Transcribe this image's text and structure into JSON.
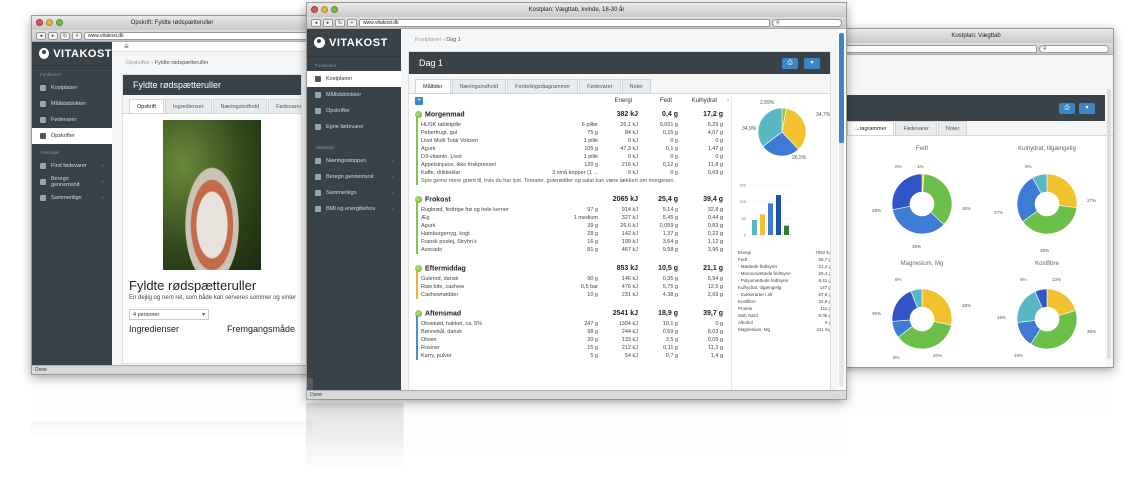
{
  "left_window": {
    "title": "Opskrift: Fyldte rødspætteruller",
    "url": "www.vitakost.dk",
    "logo": "VITAKOST",
    "sidebar_group1": "Funktioner",
    "sidebar_items": [
      {
        "label": "Kostplaner",
        "active": false
      },
      {
        "label": "Måltidsblokker",
        "active": false
      },
      {
        "label": "Fødevarer",
        "active": false
      },
      {
        "label": "Opskrifter",
        "active": true
      }
    ],
    "sidebar_group2": "Værktøjer",
    "sidebar_tools": [
      {
        "label": "Find fødevarer"
      },
      {
        "label": "Beregn gennemsnit"
      },
      {
        "label": "Sammenlign"
      }
    ],
    "breadcrumb": [
      "Opskrifter",
      "Fyldte rødspætteruller"
    ],
    "panel_title": "Fyldte rødspætteruller",
    "tabs": [
      "Opskrift",
      "Ingredienser",
      "Næringsindhold",
      "Fødevarer"
    ],
    "recipe_title": "Fyldte rødspætteruller",
    "recipe_sub": "En dejlig og nem ret, som både kan serveres sommer og vinter",
    "servings_value": "4 personer",
    "ingredients_heading": "Ingredienser",
    "method_heading": "Fremgangsmåde",
    "status": "Done"
  },
  "center_window": {
    "title": "Kostplan: Vægttab, kvinde, 18-30 år",
    "url": "www.vitakost.dk",
    "logo": "VITAKOST",
    "sidebar_group1": "Funktioner",
    "sidebar_items": [
      {
        "label": "Kostplaner",
        "active": true
      },
      {
        "label": "Måltidsblokker",
        "active": false
      },
      {
        "label": "Opskrifter",
        "active": false
      },
      {
        "label": "Egne fødevarer",
        "active": false
      }
    ],
    "sidebar_group2": "Værktøjer",
    "sidebar_tools": [
      {
        "label": "Næringsstoppen"
      },
      {
        "label": "Beregn gennemsnit"
      },
      {
        "label": "Sammenlign"
      },
      {
        "label": "BMI og energibehov"
      }
    ],
    "breadcrumb": [
      "Kostplaner",
      "Dag 1"
    ],
    "panel_title": "Dag 1",
    "tabs": [
      "Måltider",
      "Næringsindhold",
      "Fordelingsdiagrammer",
      "Fødevarer",
      "Noter"
    ],
    "columns": [
      "Energi",
      "Fedt",
      "Kulhydrat"
    ],
    "meals": [
      {
        "name": "Morgenmad",
        "energy": "382 kJ",
        "fat": "0,4 g",
        "carb": "17,2 g",
        "color": "#8bc34a",
        "rows": [
          [
            "HUSK tabletpille",
            "6 piller",
            "26,1 kJ",
            "0,021 g",
            "6,29 g"
          ],
          [
            "Peberfrugt, gul",
            "75 g",
            "84 kJ",
            "0,15 g",
            "4,07 g"
          ],
          [
            "Livol Multi Total Voksen",
            "1 pille",
            "0 kJ",
            "0 g",
            "0 g"
          ],
          [
            "Agurk",
            "105 g",
            "47,3 kJ",
            "0,1 g",
            "1,47 g"
          ],
          [
            "D3-vitamin, Livol",
            "1 pille",
            "0 kJ",
            "0 g",
            "0 g"
          ],
          [
            "Appelsinjuice, ikke friskpresset",
            "120 g",
            "216 kJ",
            "0,12 g",
            "11,8 g"
          ],
          [
            "Kaffe, drikkeklar",
            "3 små kopper (1 ...",
            "9 kJ",
            "0 g",
            "0,69 g"
          ]
        ],
        "note": "Spis gerne mere grønt til, hvis du har lyst. Tomater, gulerødder og salat kan være lækkert om morgenen."
      },
      {
        "name": "Frokost",
        "energy": "2065 kJ",
        "fat": "25,4 g",
        "carb": "39,4 g",
        "color": "#8bc34a",
        "rows": [
          [
            "Rugbrød, fedtrige frø og hele kerner",
            "97 g",
            "914 kJ",
            "5,14 g",
            "32,8 g"
          ],
          [
            "Æg",
            "1 medium",
            "327 kJ",
            "5,45 g",
            "0,44 g"
          ],
          [
            "Agurk",
            "39 g",
            "26,6 kJ",
            "0,059 g",
            "0,83 g"
          ],
          [
            "Hamburgerryg, kogt",
            "28 g",
            "142 kJ",
            "1,37 g",
            "0,22 g"
          ],
          [
            "Fransk postej, Stryhn's",
            "16 g",
            "199 kJ",
            "3,64 g",
            "1,12 g"
          ],
          [
            "Avocado",
            "81 g",
            "467 kJ",
            "9,58 g",
            "3,96 g"
          ]
        ],
        "note": ""
      },
      {
        "name": "Eftermiddag",
        "energy": "853 kJ",
        "fat": "10,5 g",
        "carb": "21,1 g",
        "color": "#f2b134",
        "rows": [
          [
            "Gulerod, dansk",
            "90 g",
            "146 kJ",
            "0,35 g",
            "5,94 g"
          ],
          [
            "Raw bite, cashew",
            "0,5 bar",
            "476 kJ",
            "5,75 g",
            "12,5 g"
          ],
          [
            "Cashewnødder",
            "10 g",
            "231 kJ",
            "4,38 g",
            "2,69 g"
          ]
        ],
        "note": ""
      },
      {
        "name": "Aftensmad",
        "energy": "2541 kJ",
        "fat": "18,9 g",
        "carb": "39,7 g",
        "color": "#4a8fd6",
        "rows": [
          [
            "Oksekød, hakket, ca. 5%",
            "247 g",
            "1304 kJ",
            "10,1 g",
            "0 g"
          ],
          [
            "Bønnekål, dansk",
            "98 g",
            "244 kJ",
            "0,69 g",
            "8,03 g"
          ],
          [
            "Oliven",
            "20 g",
            "133 kJ",
            "3,5 g",
            "0,05 g"
          ],
          [
            "Rosiner",
            "15 g",
            "212 kJ",
            "0,11 g",
            "11,3 g"
          ],
          [
            "Karry, pulver",
            "5 g",
            "54 kJ",
            "0,7 g",
            "1,4 g"
          ]
        ],
        "note": ""
      }
    ],
    "pie_labels": [
      "2,89%",
      "34,7%",
      "34,9%",
      "26,5%"
    ],
    "pie_data": [
      2.89,
      34.7,
      26.5,
      34.9
    ],
    "pie_colors": [
      "#8bc34a",
      "#f2c12e",
      "#3f7bd4",
      "#59b7c4"
    ],
    "bar_ylim": [
      0,
      150
    ],
    "bar_ticks": [
      "150",
      "100",
      "50",
      "0"
    ],
    "bar_data": [
      {
        "value": 45,
        "color": "#59b7c4"
      },
      {
        "value": 62,
        "color": "#f2c12e"
      },
      {
        "value": 95,
        "color": "#3f7bd4"
      },
      {
        "value": 120,
        "color": "#1f4fa8"
      },
      {
        "value": 28,
        "color": "#2e7d32"
      }
    ],
    "nutrient_table": [
      [
        "Energi",
        "7092 kJ"
      ],
      [
        "Fedt",
        "66,7 g"
      ],
      [
        "- Mættede fedtsyrer",
        "21,2 g"
      ],
      [
        "- Monoumættede fedtsyrer",
        "26,4 g"
      ],
      [
        "- Polyumættede fedtsyrer",
        "8,41 g"
      ],
      [
        "Kulhydrat, tilgængelig",
        "147 g"
      ],
      [
        "- Sukkerarter i alt",
        "67,8 g"
      ],
      [
        "Kostfibre",
        "32,9 g"
      ],
      [
        "Protein",
        "111 g"
      ],
      [
        "Salt, NaCl",
        "8,06 g"
      ],
      [
        "Alkohol",
        "0 g"
      ],
      [
        "Magnesium, Mg",
        "411 mg"
      ]
    ],
    "status": "Done"
  },
  "right_window": {
    "title": "Kostplan: Vægttab",
    "tabs": [
      "...ragrammer",
      "Fødevarer",
      "Noter"
    ],
    "charts": [
      {
        "title": "Fedt",
        "labels": [
          "0%",
          "1%",
          "36%",
          "28%",
          "35%"
        ],
        "values": [
          1,
          36,
          35,
          28
        ],
        "colors": [
          "#f2c12e",
          "#6cc04a",
          "#3f7bd4",
          "#2f55c7"
        ]
      },
      {
        "title": "Kulhydrat, tilgængelig",
        "labels": [
          "8%",
          "27%",
          "27%",
          "38%"
        ],
        "values": [
          27,
          38,
          27,
          8
        ],
        "colors": [
          "#f2c12e",
          "#6cc04a",
          "#3f7bd4",
          "#59b7c4"
        ]
      },
      {
        "title": "Magnesium, Mg",
        "labels": [
          "6%",
          "28%",
          "36%",
          "9%",
          "20%"
        ],
        "values": [
          28,
          36,
          9,
          20,
          6
        ],
        "colors": [
          "#f2c12e",
          "#6cc04a",
          "#3f7bd4",
          "#2f55c7",
          "#59b7c4"
        ]
      },
      {
        "title": "Kostfibre",
        "labels": [
          "6%",
          "19%",
          "36%",
          "19%",
          "13%"
        ],
        "values": [
          19,
          36,
          13,
          19,
          6
        ],
        "colors": [
          "#f2c12e",
          "#6cc04a",
          "#3f7bd4",
          "#59b7c4",
          "#2f55c7"
        ]
      }
    ]
  }
}
